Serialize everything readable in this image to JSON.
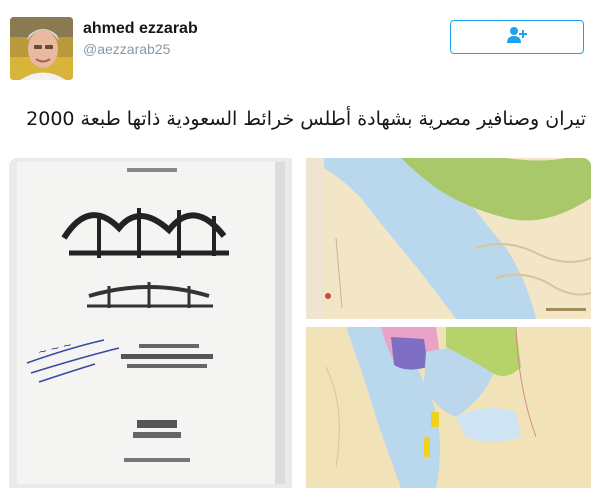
{
  "user": {
    "display_name": "ahmed ezzarab",
    "handle": "@aezzarab25"
  },
  "tweet": {
    "text": "تيران وصنافير  مصرية بشهادة أطلس خرائط السعودية ذاتها طبعة 2000"
  },
  "icons": {
    "follow": "add-user-icon"
  },
  "colors": {
    "accent": "#1da1f2",
    "name": "#14171a",
    "handle": "#8899a6"
  }
}
